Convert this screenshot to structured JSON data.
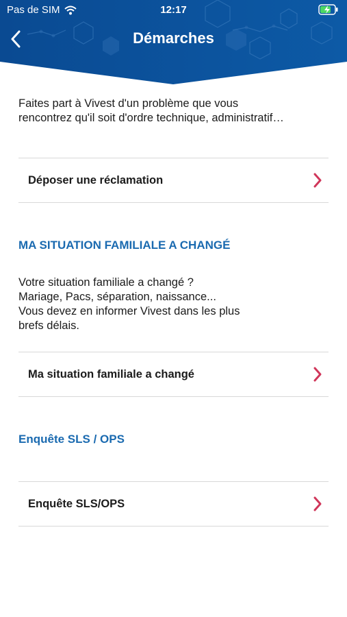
{
  "status_bar": {
    "carrier": "Pas de SIM",
    "time": "12:17",
    "icons": [
      "wifi-icon",
      "battery-charging-icon"
    ]
  },
  "header": {
    "title": "Démarches",
    "back_icon": "chevron-left-icon",
    "background_color": "#0b4f97"
  },
  "intro": {
    "text_line1": "Faites part à Vivest d'un problème que vous",
    "text_line2": "rencontrez qu'il soit d'ordre technique, administratif…"
  },
  "rows": [
    {
      "label": "Déposer une réclamation"
    },
    {
      "label": "Ma situation familiale a changé"
    },
    {
      "label": "Enquête SLS/OPS"
    }
  ],
  "sections": {
    "family": {
      "title": "MA SITUATION FAMILIALE A CHANGÉ",
      "line1": "Votre situation familiale a changé ?",
      "line2": "Mariage, Pacs, séparation, naissance...",
      "line3": "Vous devez en informer Vivest dans les plus",
      "line4": "brefs délais."
    },
    "survey": {
      "title": "Enquête SLS / OPS"
    }
  },
  "colors": {
    "accent_chevron": "#d0365a",
    "section_title": "#1a6ab0",
    "divider": "#d8d8d8"
  }
}
